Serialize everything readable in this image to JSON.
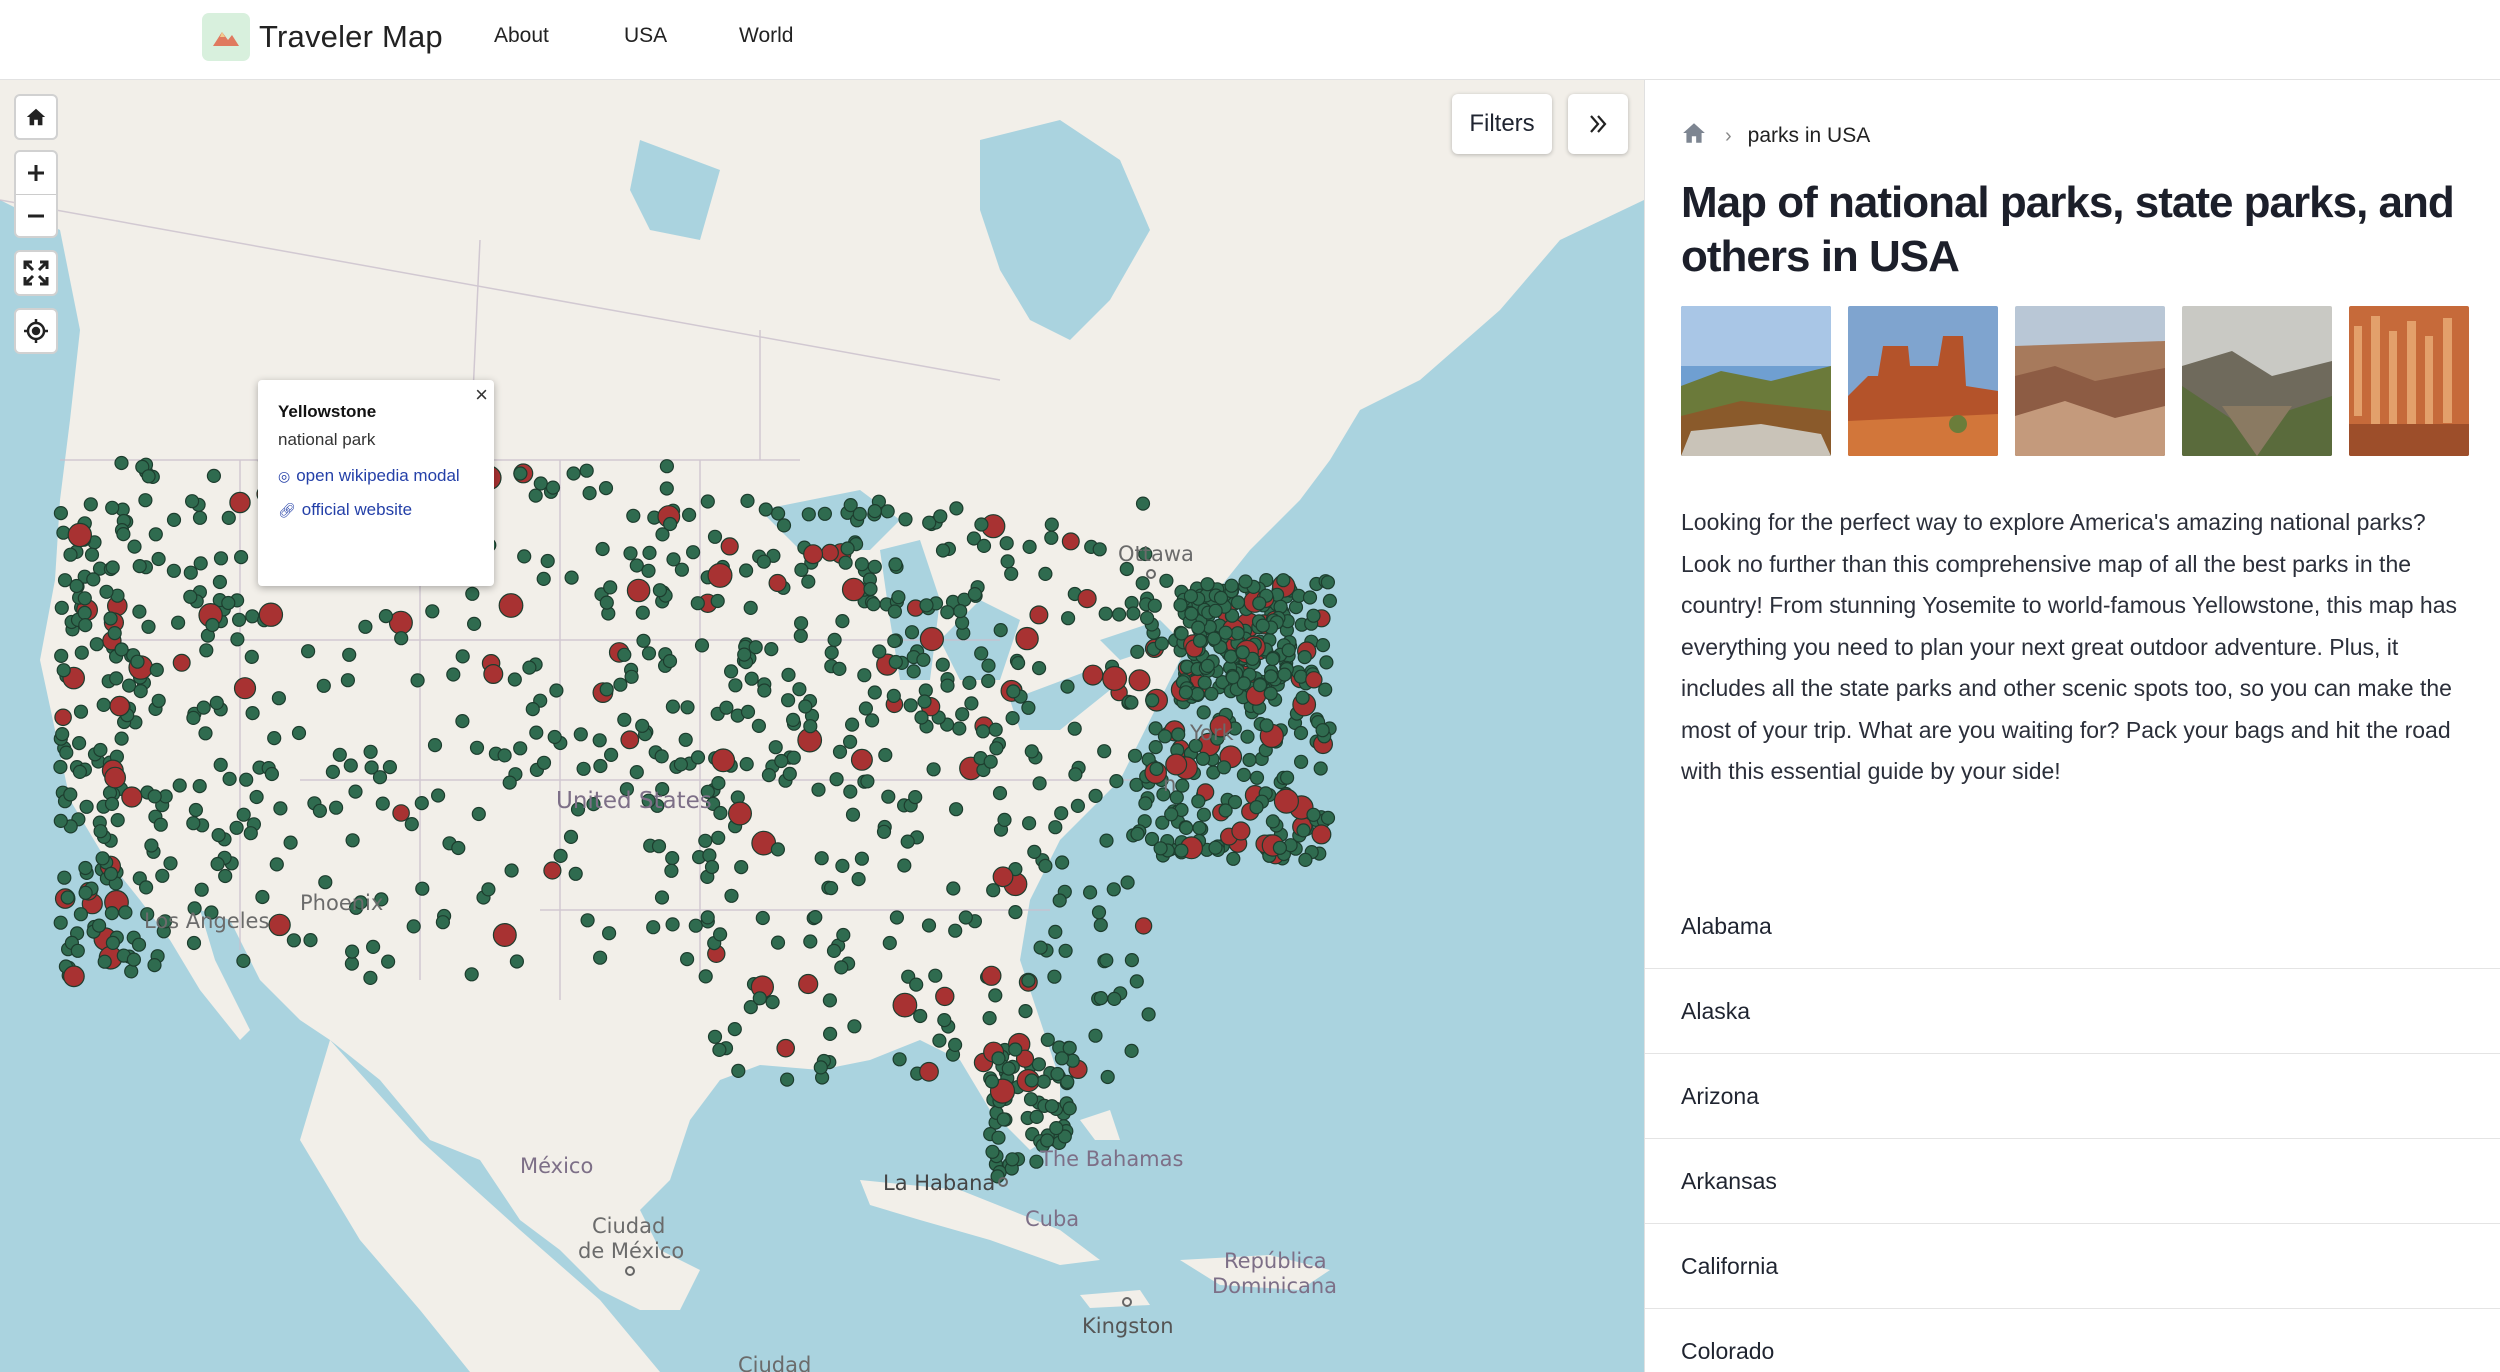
{
  "header": {
    "brand": "Traveler Map",
    "nav": [
      "About",
      "USA",
      "World"
    ]
  },
  "map": {
    "filters_label": "Filters",
    "labels": {
      "ottawa": "Ottawa",
      "united_states": "United States",
      "york": "York",
      "washington_fragment": "n",
      "los_angeles": "Los Angeles",
      "phoenix": "Phoenix",
      "mexico": "México",
      "ciudad_mexico_1": "Ciudad",
      "ciudad_mexico_2": "de México",
      "la_habana": "La Habana",
      "cuba": "Cuba",
      "bahamas": "The Bahamas",
      "republica_1": "República",
      "republica_2": "Dominicana",
      "kingston": "Kingston",
      "ciudad_bottom": "Ciudad"
    },
    "popup": {
      "title": "Yellowstone",
      "type": "national park",
      "wiki_link": "open wikipedia modal",
      "website_link": "official website"
    },
    "colors": {
      "park_marker": "#2f6b4f",
      "national_marker": "#a83232",
      "water": "#aad3df",
      "land": "#f2efe9"
    }
  },
  "panel": {
    "breadcrumb": "parks in USA",
    "title": "Map of national parks, state parks, and others in USA",
    "description": "Looking for the perfect way to explore America's amazing national parks? Look no further than this comprehensive map of all the best parks in the country! From stunning Yosemite to world-famous Yellowstone, this map has everything you need to plan your next great outdoor adventure. Plus, it includes all the state parks and other scenic spots too, so you can make the most of your trip. What are you waiting for? Pack your bags and hit the road with this essential guide by your side!",
    "states": [
      "Alabama",
      "Alaska",
      "Arizona",
      "Arkansas",
      "California",
      "Colorado"
    ]
  }
}
